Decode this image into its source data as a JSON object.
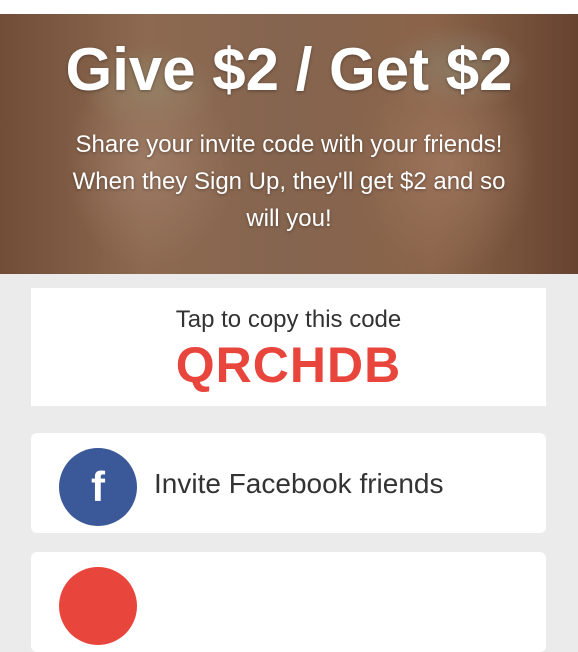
{
  "hero": {
    "title": "Give $2 / Get $2",
    "subtitle": "Share your invite code with your friends! When they Sign Up, they'll get $2 and so will you!"
  },
  "code_card": {
    "label": "Tap to copy this code",
    "code": "QRCHDB"
  },
  "invite_options": [
    {
      "label": "Invite Facebook friends",
      "icon": "facebook-icon",
      "icon_glyph": "f",
      "icon_color": "#3b5998"
    },
    {
      "icon": "partially-visible-icon",
      "icon_color": "#e8453c"
    }
  ],
  "colors": {
    "accent": "#e8453c",
    "facebook": "#3b5998",
    "background": "#ebebeb"
  }
}
